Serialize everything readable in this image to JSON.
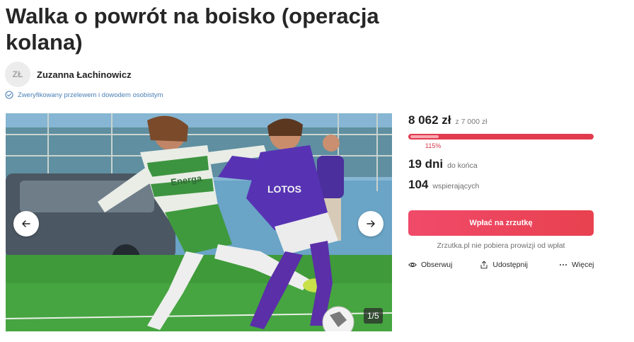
{
  "title": "Walka o powrót na boisko (operacja kolana)",
  "author": {
    "initials": "ZŁ",
    "name": "Zuzanna Łachinowicz"
  },
  "verification": {
    "text": "Zweryfikowany przelewem i dowodem osobistym",
    "icon": "check-circle-icon"
  },
  "gallery": {
    "counter": "1/5",
    "prev_icon": "arrow-left-icon",
    "next_icon": "arrow-right-icon",
    "jersey_texts": [
      "Energa",
      "LOTOS"
    ]
  },
  "fundraiser": {
    "raised": "8 062 zł",
    "goal": "z 7 000 zł",
    "progress_fraction": 1.0,
    "percent_label": "115%",
    "days_value": "19 dni",
    "days_label": "do końca",
    "supporters_value": "104",
    "supporters_label": "wspierających",
    "cta_label": "Wpłać na zrzutkę",
    "fee_note": "Zrzutka.pl nie pobiera prowizji od wpłat"
  },
  "actions": {
    "observe": "Obserwuj",
    "share": "Udostępnij",
    "more": "Więcej"
  },
  "colors": {
    "accent": "#e8414f",
    "progress_bg": "#e23a4f",
    "progress_fill": "#f7a9b3",
    "verified": "#4a7fb5"
  }
}
